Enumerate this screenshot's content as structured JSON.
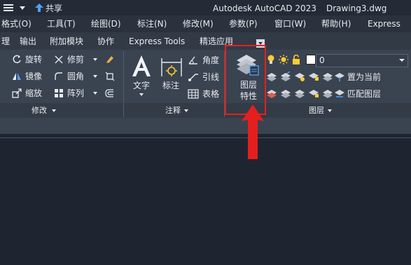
{
  "titlebar": {
    "share": "共享",
    "app_title": "Autodesk AutoCAD 2023",
    "file_name": "Drawing3.dwg"
  },
  "menu": [
    "格式(O)",
    "工具(T)",
    "绘图(D)",
    "标注(N)",
    "修改(M)",
    "参数(P)",
    "窗口(W)",
    "帮助(H)",
    "Express"
  ],
  "tabs": [
    "理",
    "输出",
    "附加模块",
    "协作",
    "Express Tools",
    "精选应用"
  ],
  "ribbon": {
    "modify_items": [
      "旋转",
      "修剪",
      "镜像",
      "圆角",
      "缩放",
      "阵列"
    ],
    "modify_panel": "修改",
    "text_label": "文字",
    "dim_label": "标注",
    "annotation_items": [
      "角度",
      "引线",
      "表格"
    ],
    "annotation_panel": "注释",
    "layer_props": [
      "图层",
      "特性"
    ],
    "layer_value": "0",
    "layer_items": [
      "置为当前",
      "匹配图层"
    ],
    "layer_panel": "图层"
  },
  "colors": {
    "highlight": "#e51f1f",
    "accent": "#ffcc33"
  },
  "icons": [
    "hamburger-icon",
    "share-icon",
    "rotate-icon",
    "trim-icon",
    "mirror-icon",
    "fillet-icon",
    "scale-icon",
    "array-icon",
    "text-icon",
    "dimension-icon",
    "angle-icon",
    "leader-icon",
    "table-icon",
    "layer-properties-icon",
    "bulb-icon",
    "sun-icon",
    "lock-icon",
    "arrow-up-icon"
  ]
}
